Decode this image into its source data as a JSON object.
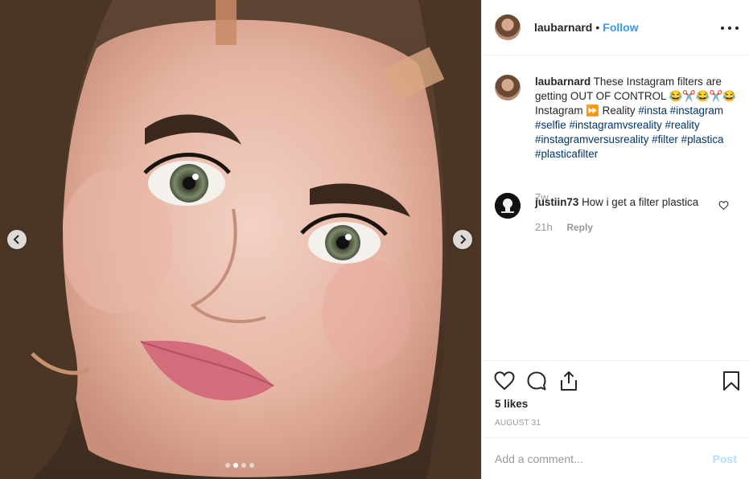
{
  "post": {
    "username": "laubarnard",
    "separator": "•",
    "follow_label": "Follow",
    "more_icon": "more-options-icon"
  },
  "caption": {
    "username": "laubarnard",
    "text": "These Instagram filters are getting OUT OF CONTROL 😂✂️😂✂️😂 Instagram ⏩ Reality",
    "hashtags": [
      "#insta",
      "#instagram",
      "#selfie",
      "#instagramvsreality",
      "#reality",
      "#instagramversusreality",
      "#filter",
      "#plastica",
      "#plasticafilter"
    ],
    "time": "7w"
  },
  "comments": [
    {
      "username": "justiin73",
      "text": "How i get a filter plastica",
      "time": "21h",
      "reply_label": "Reply"
    }
  ],
  "actions": {
    "likes": "5 likes",
    "date": "AUGUST 31",
    "icons": [
      "heart-icon",
      "comment-icon",
      "share-icon",
      "bookmark-icon"
    ]
  },
  "composer": {
    "placeholder": "Add a comment...",
    "post_label": "Post"
  },
  "carousel": {
    "slide_count": 4,
    "active_index": 1
  },
  "colors": {
    "link_blue": "#3897f0",
    "hashtag": "#003569",
    "muted": "#999999",
    "post_disabled": "#b2dffc"
  }
}
